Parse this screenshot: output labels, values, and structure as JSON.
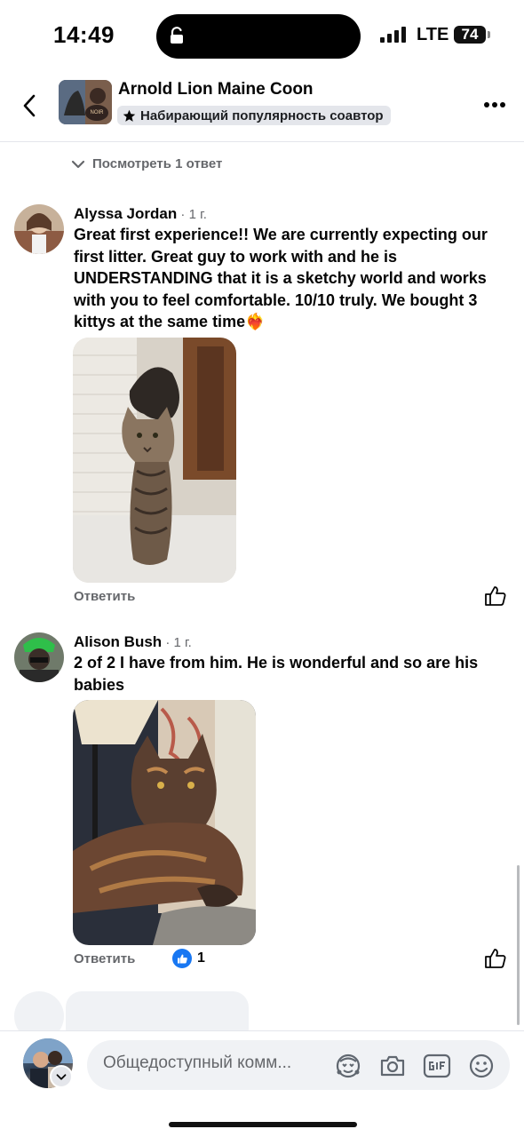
{
  "status_bar": {
    "time": "14:49",
    "network": "LTE",
    "battery": "74"
  },
  "header": {
    "title": "Arnold Lion Maine Coon",
    "badge": "Набирающий популярность соавтор"
  },
  "view_replies": "Посмотреть 1 ответ",
  "comments": [
    {
      "author": "Alyssa Jordan",
      "time": " · 1 г.",
      "text": "Great first experience!! We are currently expecting our first litter. Great guy to work with and he is UNDERSTANDING that it is a sketchy world and works with you to feel comfortable. 10/10 truly. We bought 3 kittys at the same time❤️‍🔥",
      "reply_label": "Ответить",
      "likes": ""
    },
    {
      "author": "Alison Bush",
      "time": " · 1 г.",
      "text": "2 of 2 I have from him.  He is wonderful and so are his babies",
      "reply_label": "Ответить",
      "likes": "1"
    }
  ],
  "composer": {
    "placeholder": "Общедоступный комм..."
  },
  "colors": {
    "accent": "#1877f2",
    "muted_text": "#65676b",
    "bubble_bg": "#f0f2f5"
  },
  "icons": [
    "back-arrow-icon",
    "more-icon",
    "star-icon",
    "chevron-down-icon",
    "like-icon",
    "avatar-frame-icon",
    "camera-icon",
    "gif-icon",
    "emoji-icon"
  ]
}
